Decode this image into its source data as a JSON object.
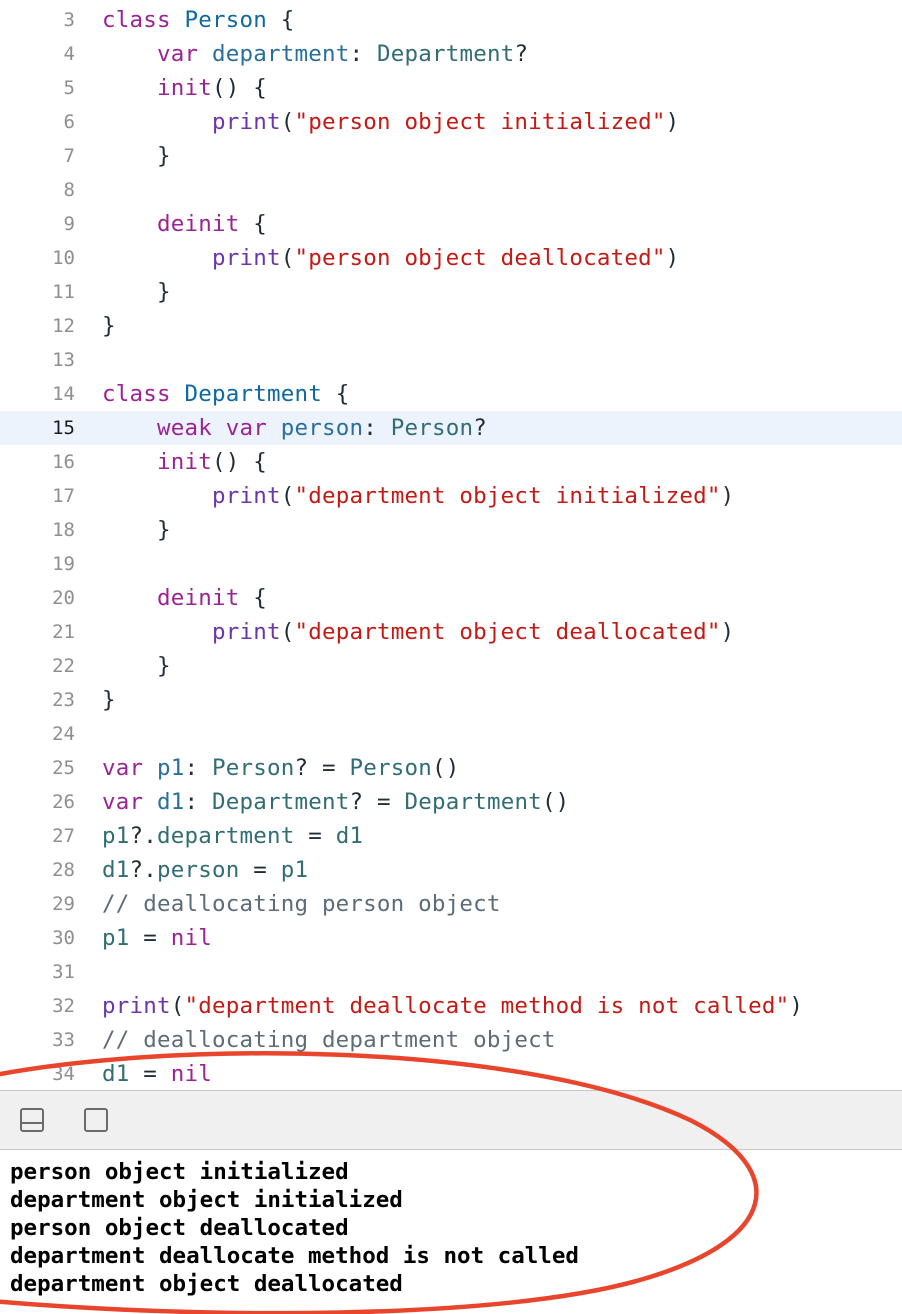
{
  "editor": {
    "current_line": 15,
    "lines": [
      {
        "n": "3",
        "t": [
          [
            "k",
            "class"
          ],
          [
            "p",
            " "
          ],
          [
            "ty",
            "Person"
          ],
          [
            "p",
            " {"
          ]
        ]
      },
      {
        "n": "4",
        "t": [
          [
            "p",
            "    "
          ],
          [
            "k",
            "var"
          ],
          [
            "p",
            " "
          ],
          [
            "v",
            "department"
          ],
          [
            "p",
            ": "
          ],
          [
            "r",
            "Department"
          ],
          [
            "p",
            "?"
          ]
        ]
      },
      {
        "n": "5",
        "t": [
          [
            "p",
            "    "
          ],
          [
            "k",
            "init"
          ],
          [
            "p",
            "() {"
          ]
        ]
      },
      {
        "n": "6",
        "t": [
          [
            "p",
            "        "
          ],
          [
            "f",
            "print"
          ],
          [
            "p",
            "("
          ],
          [
            "s",
            "\"person object initialized\""
          ],
          [
            "p",
            ")"
          ]
        ]
      },
      {
        "n": "7",
        "t": [
          [
            "p",
            "    }"
          ]
        ]
      },
      {
        "n": "8",
        "t": []
      },
      {
        "n": "9",
        "t": [
          [
            "p",
            "    "
          ],
          [
            "k",
            "deinit"
          ],
          [
            "p",
            " {"
          ]
        ]
      },
      {
        "n": "10",
        "t": [
          [
            "p",
            "        "
          ],
          [
            "f",
            "print"
          ],
          [
            "p",
            "("
          ],
          [
            "s",
            "\"person object deallocated\""
          ],
          [
            "p",
            ")"
          ]
        ]
      },
      {
        "n": "11",
        "t": [
          [
            "p",
            "    }"
          ]
        ]
      },
      {
        "n": "12",
        "t": [
          [
            "p",
            "}"
          ]
        ]
      },
      {
        "n": "13",
        "t": []
      },
      {
        "n": "14",
        "t": [
          [
            "k",
            "class"
          ],
          [
            "p",
            " "
          ],
          [
            "ty",
            "Department"
          ],
          [
            "p",
            " {"
          ]
        ]
      },
      {
        "n": "15",
        "t": [
          [
            "p",
            "    "
          ],
          [
            "k",
            "weak"
          ],
          [
            "p",
            " "
          ],
          [
            "k",
            "var"
          ],
          [
            "p",
            " "
          ],
          [
            "v",
            "person"
          ],
          [
            "p",
            ": "
          ],
          [
            "r",
            "Person"
          ],
          [
            "p",
            "?"
          ]
        ]
      },
      {
        "n": "16",
        "t": [
          [
            "p",
            "    "
          ],
          [
            "k",
            "init"
          ],
          [
            "p",
            "() {"
          ]
        ]
      },
      {
        "n": "17",
        "t": [
          [
            "p",
            "        "
          ],
          [
            "f",
            "print"
          ],
          [
            "p",
            "("
          ],
          [
            "s",
            "\"department object initialized\""
          ],
          [
            "p",
            ")"
          ]
        ]
      },
      {
        "n": "18",
        "t": [
          [
            "p",
            "    }"
          ]
        ]
      },
      {
        "n": "19",
        "t": []
      },
      {
        "n": "20",
        "t": [
          [
            "p",
            "    "
          ],
          [
            "k",
            "deinit"
          ],
          [
            "p",
            " {"
          ]
        ]
      },
      {
        "n": "21",
        "t": [
          [
            "p",
            "        "
          ],
          [
            "f",
            "print"
          ],
          [
            "p",
            "("
          ],
          [
            "s",
            "\"department object deallocated\""
          ],
          [
            "p",
            ")"
          ]
        ]
      },
      {
        "n": "22",
        "t": [
          [
            "p",
            "    }"
          ]
        ]
      },
      {
        "n": "23",
        "t": [
          [
            "p",
            "}"
          ]
        ]
      },
      {
        "n": "24",
        "t": []
      },
      {
        "n": "25",
        "t": [
          [
            "k",
            "var"
          ],
          [
            "p",
            " "
          ],
          [
            "v",
            "p1"
          ],
          [
            "p",
            ": "
          ],
          [
            "r",
            "Person"
          ],
          [
            "p",
            "? = "
          ],
          [
            "r",
            "Person"
          ],
          [
            "p",
            "()"
          ]
        ]
      },
      {
        "n": "26",
        "t": [
          [
            "k",
            "var"
          ],
          [
            "p",
            " "
          ],
          [
            "v",
            "d1"
          ],
          [
            "p",
            ": "
          ],
          [
            "r",
            "Department"
          ],
          [
            "p",
            "? = "
          ],
          [
            "r",
            "Department"
          ],
          [
            "p",
            "()"
          ]
        ]
      },
      {
        "n": "27",
        "t": [
          [
            "r",
            "p1"
          ],
          [
            "p",
            "?."
          ],
          [
            "r",
            "department"
          ],
          [
            "p",
            " = "
          ],
          [
            "r",
            "d1"
          ]
        ]
      },
      {
        "n": "28",
        "t": [
          [
            "r",
            "d1"
          ],
          [
            "p",
            "?."
          ],
          [
            "r",
            "person"
          ],
          [
            "p",
            " = "
          ],
          [
            "r",
            "p1"
          ]
        ]
      },
      {
        "n": "29",
        "t": [
          [
            "c",
            "// deallocating person object"
          ]
        ]
      },
      {
        "n": "30",
        "t": [
          [
            "r",
            "p1"
          ],
          [
            "p",
            " = "
          ],
          [
            "k",
            "nil"
          ]
        ]
      },
      {
        "n": "31",
        "t": []
      },
      {
        "n": "32",
        "t": [
          [
            "f",
            "print"
          ],
          [
            "p",
            "("
          ],
          [
            "s",
            "\"department deallocate method is not called\""
          ],
          [
            "p",
            ")"
          ]
        ]
      },
      {
        "n": "33",
        "t": [
          [
            "c",
            "// deallocating department object"
          ]
        ]
      },
      {
        "n": "34",
        "t": [
          [
            "r",
            "d1"
          ],
          [
            "p",
            " = "
          ],
          [
            "k",
            "nil"
          ]
        ]
      }
    ]
  },
  "toolbar": {
    "hide_panel_icon": "panel-bottom-icon",
    "show_panel_icon": "panel-square-icon"
  },
  "console": {
    "output": [
      "person object initialized",
      "department object initialized",
      "person object deallocated",
      "department deallocate method is not called",
      "department object deallocated"
    ]
  },
  "colors": {
    "keyword": "#9b2393",
    "type_declaration": "#0f68a0",
    "type_reference": "#326d74",
    "string": "#c41a16",
    "function": "#6c36a9",
    "comment": "#5d6c79",
    "annotation_circle": "#e8452c",
    "current_line_bg": "#ecf3fc"
  }
}
